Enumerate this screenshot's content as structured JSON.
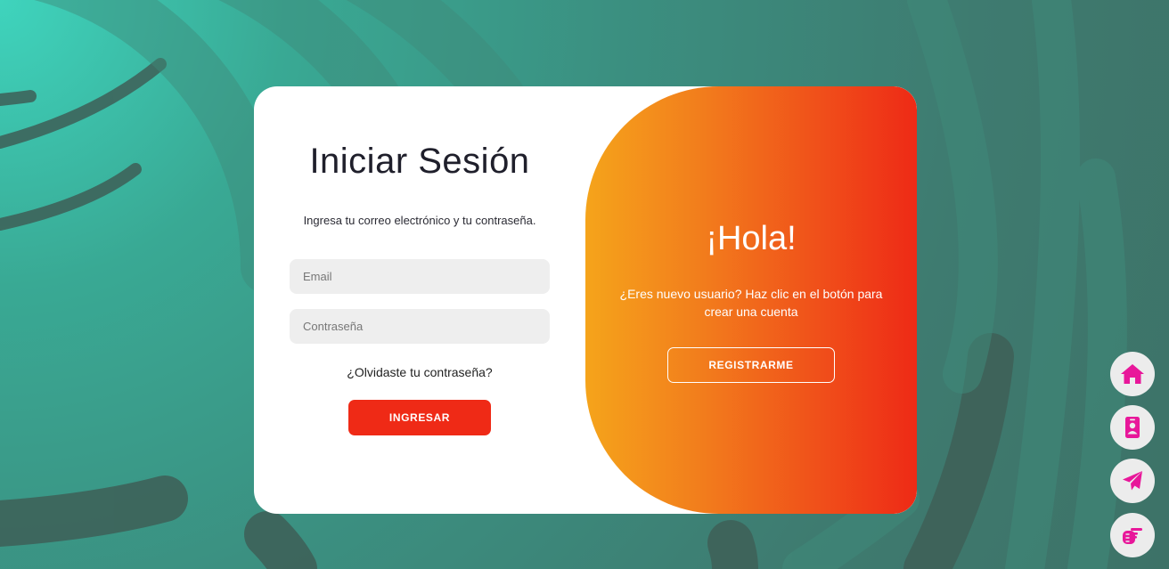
{
  "login": {
    "title": "Iniciar Sesión",
    "subtitle": "Ingresa tu correo electrónico y tu contraseña.",
    "email_placeholder": "Email",
    "password_placeholder": "Contraseña",
    "forgot_label": "¿Olvidaste tu contraseña?",
    "submit_label": "INGRESAR"
  },
  "signup": {
    "greeting": "¡Hola!",
    "message": "¿Eres nuevo usuario? Haz clic en el botón para crear una cuenta",
    "button_label": "REGISTRARME"
  },
  "floating_nav": {
    "items": [
      {
        "icon": "home-icon"
      },
      {
        "icon": "contact-card-icon"
      },
      {
        "icon": "paper-plane-icon"
      },
      {
        "icon": "pointing-hand-icon"
      }
    ]
  },
  "colors": {
    "accent_red": "#ef2a16",
    "gradient_start": "#f5a41b",
    "gradient_end": "#ee2a16",
    "icon_pink": "#e8179a",
    "background_teal": "#3b8f80"
  }
}
